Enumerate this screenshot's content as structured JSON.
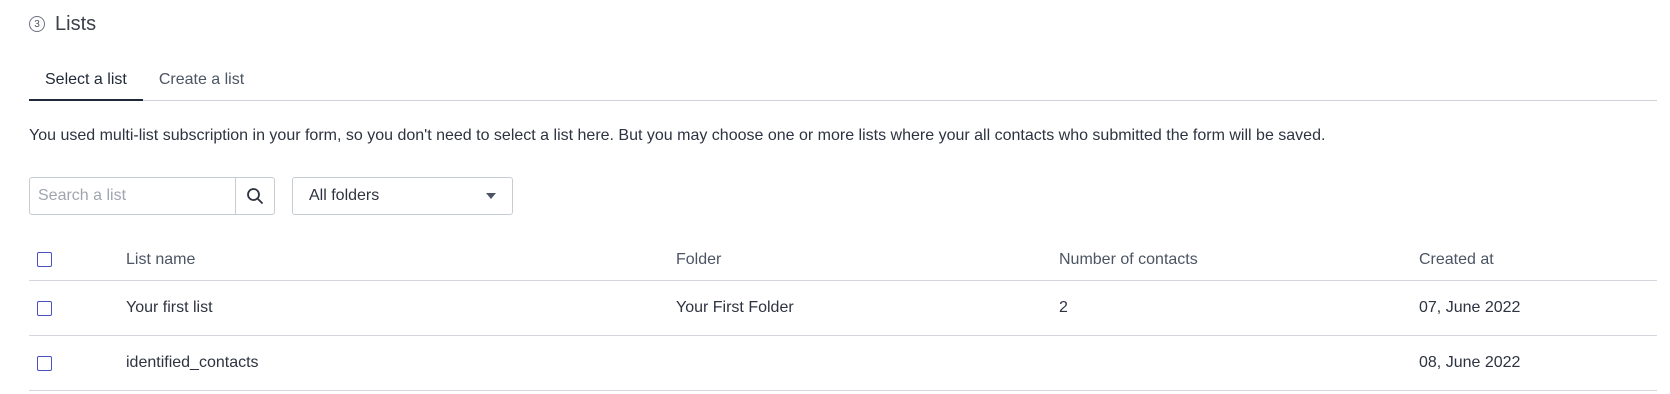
{
  "section": {
    "step": "3",
    "title": "Lists"
  },
  "tabs": [
    {
      "label": "Select a list",
      "active": true
    },
    {
      "label": "Create a list",
      "active": false
    }
  ],
  "info_text": "You used multi-list subscription in your form, so you don't need to select a list here. But you may choose one or more lists where your all contacts who submitted the form will be saved.",
  "search": {
    "placeholder": "Search a list",
    "value": "",
    "icon": "search-icon"
  },
  "folder_select": {
    "selected": "All folders"
  },
  "table": {
    "columns": [
      "List name",
      "Folder",
      "Number of contacts",
      "Created at"
    ],
    "rows": [
      {
        "name": "Your first list",
        "folder": "Your First Folder",
        "count": "2",
        "created": "07, June 2022",
        "checked": false
      },
      {
        "name": "identified_contacts",
        "folder": "",
        "count": "",
        "created": "08, June 2022",
        "checked": false
      }
    ]
  },
  "colors": {
    "checkbox_border": "#4a4fc4",
    "divider": "#d3d6dc",
    "text": "#2d3340"
  }
}
